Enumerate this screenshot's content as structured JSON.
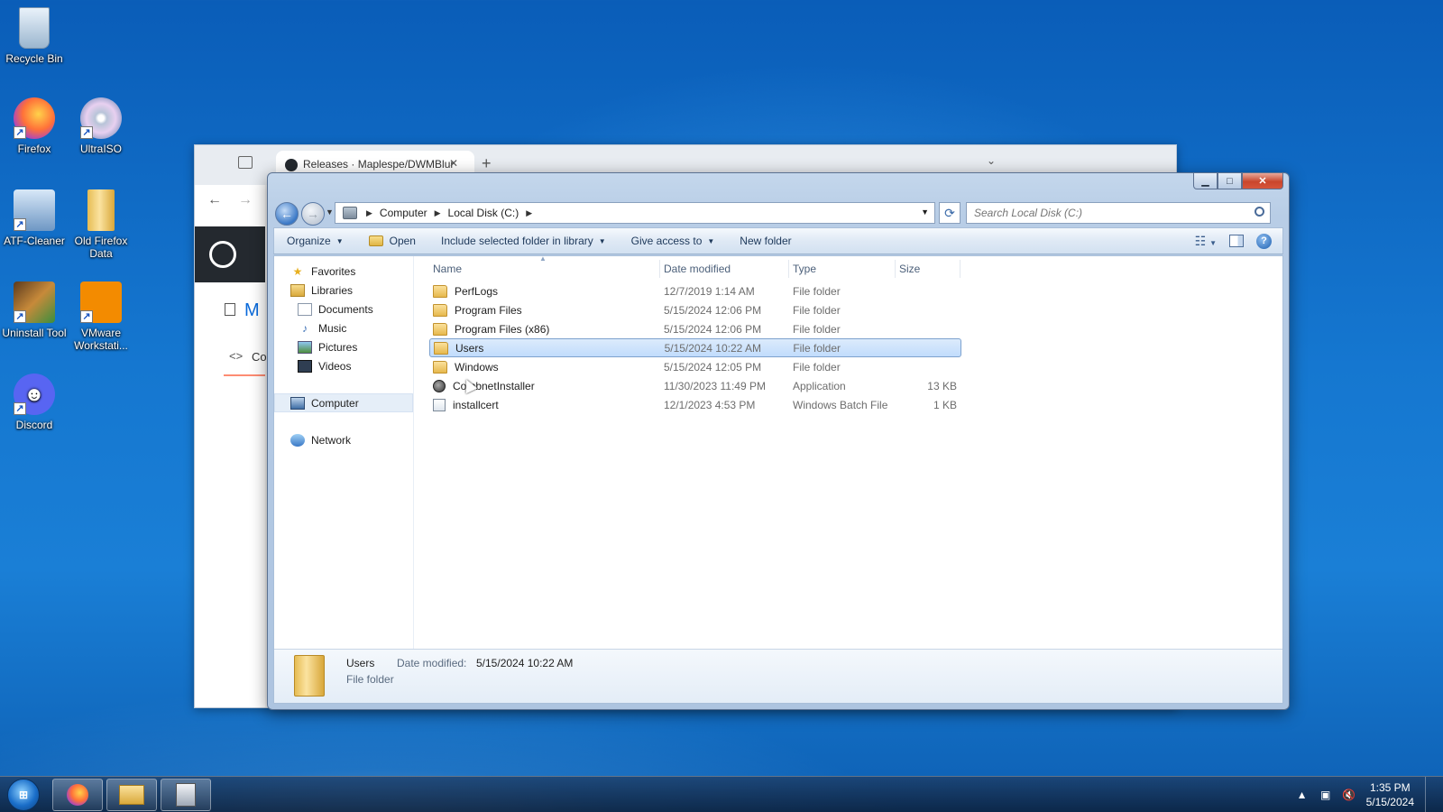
{
  "desktop": {
    "icons": [
      {
        "label": "Recycle Bin"
      },
      {
        "label": "Firefox"
      },
      {
        "label": "UltraISO"
      },
      {
        "label": "ATF-Cleaner"
      },
      {
        "label": "Old Firefox Data"
      },
      {
        "label": "Uninstall Tool"
      },
      {
        "label": "VMware Workstati..."
      },
      {
        "label": "Discord"
      }
    ]
  },
  "browser": {
    "tab_title": "Releases · Maplespe/DWMBlur",
    "new_tab": "+",
    "partial_heading": "M",
    "partial_code": "Co"
  },
  "explorer": {
    "address": {
      "crumbs": [
        "Computer",
        "Local Disk (C:)"
      ]
    },
    "search": {
      "placeholder": "Search Local Disk (C:)"
    },
    "toolbar": {
      "organize": "Organize",
      "open": "Open",
      "include": "Include selected folder in library",
      "give_access": "Give access to",
      "new_folder": "New folder"
    },
    "nav": {
      "favorites": "Favorites",
      "libraries": "Libraries",
      "documents": "Documents",
      "music": "Music",
      "pictures": "Pictures",
      "videos": "Videos",
      "computer": "Computer",
      "network": "Network"
    },
    "columns": {
      "name": "Name",
      "date": "Date modified",
      "type": "Type",
      "size": "Size"
    },
    "files": [
      {
        "name": "PerfLogs",
        "date": "12/7/2019 1:14 AM",
        "type": "File folder",
        "size": "",
        "icon": "folder"
      },
      {
        "name": "Program Files",
        "date": "5/15/2024 12:06 PM",
        "type": "File folder",
        "size": "",
        "icon": "folder"
      },
      {
        "name": "Program Files (x86)",
        "date": "5/15/2024 12:06 PM",
        "type": "File folder",
        "size": "",
        "icon": "folder"
      },
      {
        "name": "Users",
        "date": "5/15/2024 10:22 AM",
        "type": "File folder",
        "size": "",
        "icon": "folder",
        "selected": true
      },
      {
        "name": "Windows",
        "date": "5/15/2024 12:05 PM",
        "type": "File folder",
        "size": "",
        "icon": "folder"
      },
      {
        "name": "CombnetInstaller",
        "date": "11/30/2023 11:49 PM",
        "type": "Application",
        "size": "13 KB",
        "icon": "app"
      },
      {
        "name": "installcert",
        "date": "12/1/2023 4:53 PM",
        "type": "Windows Batch File",
        "size": "1 KB",
        "icon": "bat"
      }
    ],
    "details": {
      "name": "Users",
      "date_label": "Date modified:",
      "date_value": "5/15/2024 10:22 AM",
      "type": "File folder"
    }
  },
  "taskbar": {
    "time": "1:35 PM",
    "date": "5/15/2024"
  }
}
